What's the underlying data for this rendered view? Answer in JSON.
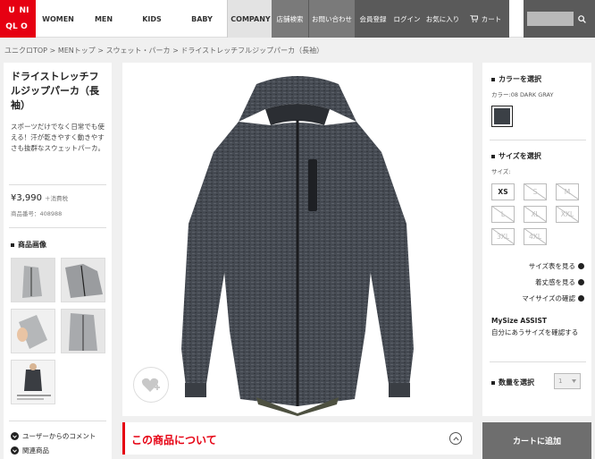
{
  "header": {
    "logo_letters": [
      "U",
      "NI",
      "QL",
      "O"
    ],
    "nav": [
      {
        "label": "WOMEN"
      },
      {
        "label": "MEN"
      },
      {
        "label": "KIDS"
      },
      {
        "label": "BABY"
      },
      {
        "label": "COMPANY"
      }
    ],
    "util": {
      "store": "店舗検索",
      "contact": "お問い合わせ",
      "member": "会員登録",
      "login": "ログイン",
      "favorites": "お気に入り",
      "cart": "カート"
    },
    "search_placeholder": ""
  },
  "breadcrumb": {
    "items": [
      "ユニクロTOP",
      "MENトップ",
      "スウェット・パーカ",
      "ドライストレッチフルジップパーカ（長袖）"
    ],
    "separator": " > "
  },
  "product": {
    "title": "ドライストレッチフルジップパーカ（長袖）",
    "description": "スポーツだけでなく日常でも使える！汗が乾きやすく動きやすさも抜群なスウェットパーカ。",
    "price": "¥3,990",
    "tax_note": "＋消費税",
    "product_no": "商品番号：408988"
  },
  "left": {
    "images_label": "商品画像",
    "comments_label": "ユーザーからのコメント",
    "related_label": "関連商品"
  },
  "center": {
    "about_title": "この商品について"
  },
  "right": {
    "color_label": "カラーを選択",
    "color_value": "カラー:08 DARK GRAY",
    "size_label": "サイズを選択",
    "size_sub": "サイズ:",
    "sizes": [
      {
        "label": "XS",
        "available": true
      },
      {
        "label": "S",
        "available": false
      },
      {
        "label": "M",
        "available": false
      },
      {
        "label": "L",
        "available": false
      },
      {
        "label": "XL",
        "available": false
      },
      {
        "label": "XXL",
        "available": false
      },
      {
        "label": "3XL",
        "available": false
      },
      {
        "label": "4XL",
        "available": false
      }
    ],
    "size_chart": "サイズ表を見る",
    "fit_view": "着丈感を見る",
    "my_size_check": "マイサイズの確認",
    "mysize_title": "MySize ASSIST",
    "mysize_link": "自分にあうサイズを確認する",
    "qty_label": "数量を選択",
    "qty_value": "1",
    "cart_button": "カートに追加"
  },
  "colors": {
    "brand_red": "#e60012",
    "swatch_dark_gray": "#3b4046"
  }
}
